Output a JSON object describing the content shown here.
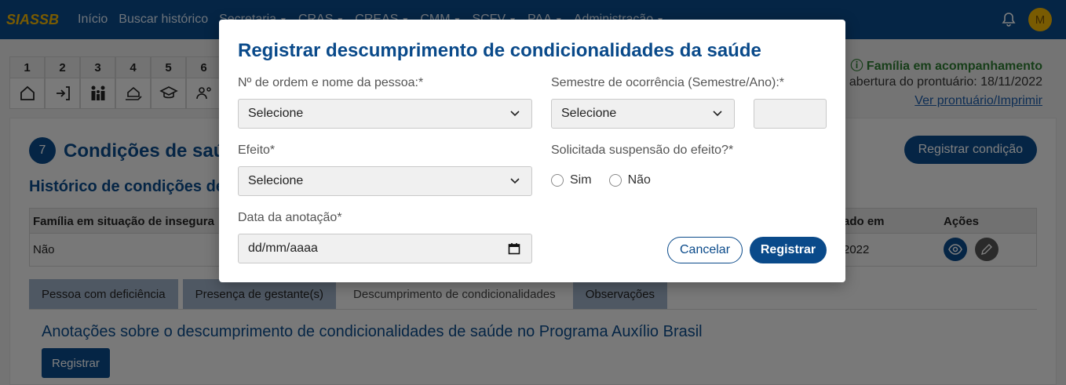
{
  "app": {
    "brand": "SIASSB"
  },
  "topnav": {
    "items": [
      {
        "label": "Início",
        "caret": false
      },
      {
        "label": "Buscar histórico",
        "caret": false
      },
      {
        "label": "Secretaria",
        "caret": true
      },
      {
        "label": "CRAS",
        "caret": true
      },
      {
        "label": "CREAS",
        "caret": true
      },
      {
        "label": "CMM",
        "caret": true
      },
      {
        "label": "SCFV",
        "caret": true
      },
      {
        "label": "PAA",
        "caret": true
      },
      {
        "label": "Administração",
        "caret": true
      }
    ],
    "avatar_initial": "M"
  },
  "steps": {
    "numbers": [
      "1",
      "2",
      "3",
      "4",
      "5",
      "6"
    ]
  },
  "family": {
    "status": "ⓘ Família em acompanhamento",
    "opening_date": "abertura do prontuário: 18/11/2022",
    "print_link": "Ver prontuário/Imprimir"
  },
  "section": {
    "number": "7",
    "title": "Condições de saúde",
    "register_button": "Registrar condição",
    "history_title": "Histórico de condições de"
  },
  "table": {
    "headers": {
      "col1": "Família em situação de insegura",
      "col_updated": "ado em",
      "col_actions": "Ações"
    },
    "row": {
      "col1": "Não",
      "col_updated": "2022"
    }
  },
  "tabs": [
    {
      "label": "Pessoa com deficiência",
      "active": false
    },
    {
      "label": "Presença de gestante(s)",
      "active": false
    },
    {
      "label": "Descumprimento de condicionalidades",
      "active": true
    },
    {
      "label": "Observações",
      "active": false
    }
  ],
  "notes": {
    "title": "Anotações sobre o descumprimento de condicionalidades de saúde no Programa Auxílio Brasil",
    "register_button": "Registrar"
  },
  "modal": {
    "title": "Registrar descumprimento de condicionalidades da saúde",
    "person_label": "Nº de ordem e nome da pessoa:*",
    "person_value": "Selecione",
    "semester_label": "Semestre de ocorrência (Semestre/Ano):*",
    "semester_value": "Selecione",
    "year_value": "",
    "effect_label": "Efeito*",
    "effect_value": "Selecione",
    "suspension_label": "Solicitada suspensão do efeito?*",
    "suspension_options": [
      "Sim",
      "Não"
    ],
    "date_label": "Data da anotação*",
    "date_placeholder": "dd/mm/aaaa",
    "cancel_button": "Cancelar",
    "register_button": "Registrar"
  },
  "colors": {
    "primary": "#0a4a8a",
    "brand_yellow": "#f2b705",
    "status_green": "#2e7d32"
  }
}
